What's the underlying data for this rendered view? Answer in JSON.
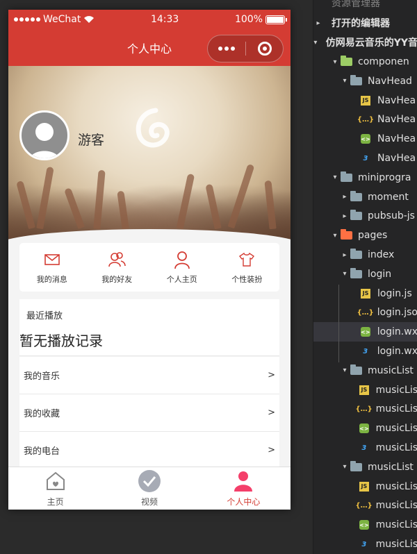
{
  "status_bar": {
    "carrier": "WeChat",
    "time": "14:33",
    "battery": "100%"
  },
  "nav_bar": {
    "title": "个人中心"
  },
  "profile": {
    "username": "游客"
  },
  "nav_section": [
    {
      "label": "我的消息",
      "icon": "mail-icon"
    },
    {
      "label": "我的好友",
      "icon": "friends-icon"
    },
    {
      "label": "个人主页",
      "icon": "person-icon"
    },
    {
      "label": "个性装扮",
      "icon": "shirt-icon"
    }
  ],
  "recent_play": {
    "title": "最近播放",
    "empty_text": "暂无播放记录"
  },
  "card_list": [
    {
      "label": "我的音乐",
      "arrow": ">"
    },
    {
      "label": "我的收藏",
      "arrow": ">"
    },
    {
      "label": "我的电台",
      "arrow": ">"
    }
  ],
  "tab_bar": [
    {
      "label": "主页",
      "icon": "home-icon",
      "active": false
    },
    {
      "label": "视频",
      "icon": "check-circle-icon",
      "active": false
    },
    {
      "label": "个人中心",
      "icon": "person-filled-icon",
      "active": true
    }
  ],
  "ide": {
    "header": "资源管理器",
    "open_editors": "打开的编辑器",
    "project": "仿网易云音乐的YY音",
    "rows": [
      {
        "label": "componen",
        "type": "folder-green",
        "caret": "▾"
      },
      {
        "label": "NavHead",
        "type": "folder",
        "caret": "▾"
      },
      {
        "label": "NavHea",
        "type": "js"
      },
      {
        "label": "NavHea",
        "type": "json"
      },
      {
        "label": "NavHea",
        "type": "wxml"
      },
      {
        "label": "NavHea",
        "type": "css"
      },
      {
        "label": "miniprogra",
        "type": "folder",
        "caret": "▾"
      },
      {
        "label": "moment",
        "type": "folder",
        "caret": "▸"
      },
      {
        "label": "pubsub-js",
        "type": "folder",
        "caret": "▸"
      },
      {
        "label": "pages",
        "type": "folder-orange",
        "caret": "▾"
      },
      {
        "label": "index",
        "type": "folder",
        "caret": "▸"
      },
      {
        "label": "login",
        "type": "folder",
        "caret": "▾"
      },
      {
        "label": "login.js",
        "type": "js"
      },
      {
        "label": "login.jso",
        "type": "json"
      },
      {
        "label": "login.wx",
        "type": "wxml",
        "selected": true
      },
      {
        "label": "login.wx",
        "type": "css"
      },
      {
        "label": "musicList",
        "type": "folder",
        "caret": "▾"
      },
      {
        "label": "musicLis",
        "type": "js"
      },
      {
        "label": "musicLis",
        "type": "json"
      },
      {
        "label": "musicLis",
        "type": "wxml"
      },
      {
        "label": "musicLis",
        "type": "css"
      },
      {
        "label": "musicList",
        "type": "folder",
        "caret": "▾"
      },
      {
        "label": "musicLis",
        "type": "js"
      },
      {
        "label": "musicLis",
        "type": "json"
      },
      {
        "label": "musicLis",
        "type": "wxml"
      },
      {
        "label": "musicLis",
        "type": "css"
      }
    ]
  }
}
